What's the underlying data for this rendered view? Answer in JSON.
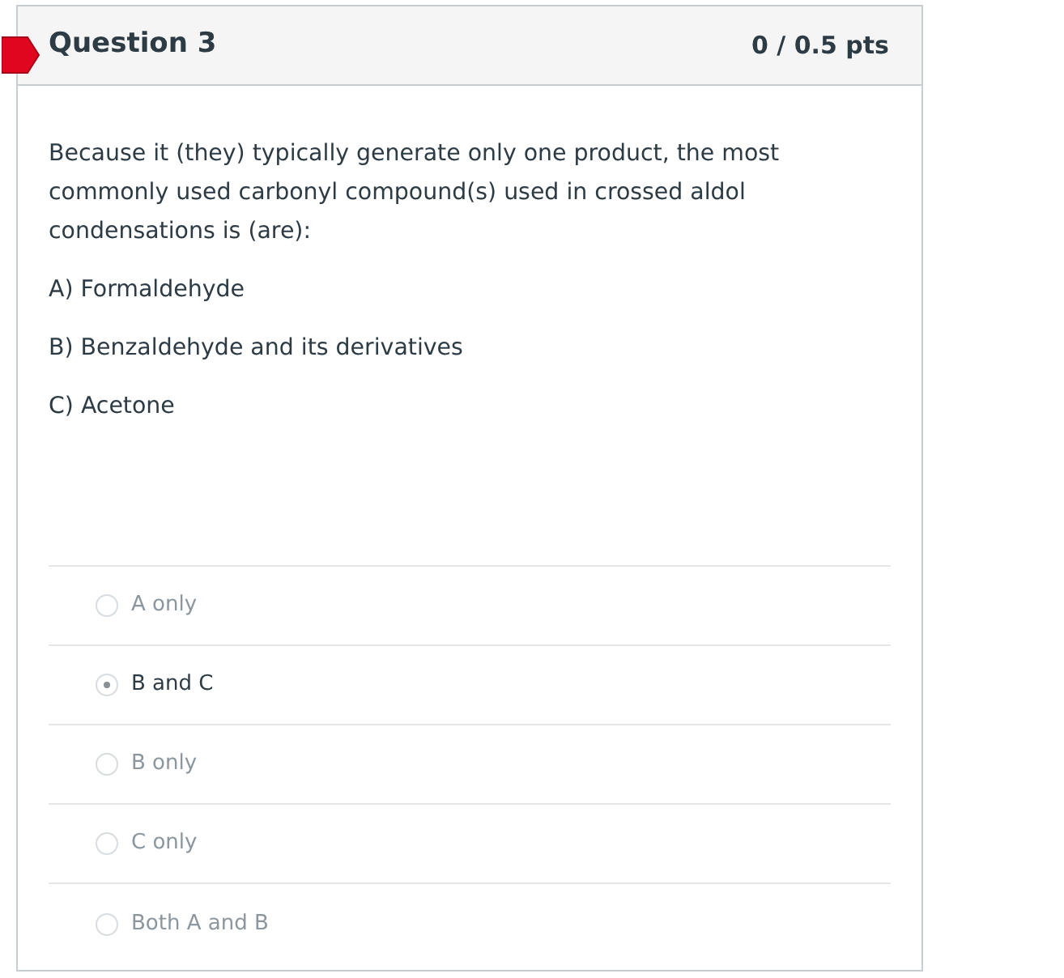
{
  "question": {
    "title": "Question 3",
    "points": "0 / 0.5 pts",
    "incorrect": true,
    "prompt": "Because it (they) typically generate only one product, the most commonly used carbonyl compound(s) used in crossed aldol condensations is (are):",
    "statements": [
      "A) Formaldehyde",
      "B) Benzaldehyde and its derivatives",
      "C) Acetone"
    ],
    "answers": [
      {
        "label": "A only",
        "selected": false
      },
      {
        "label": "B and C",
        "selected": true
      },
      {
        "label": "B only",
        "selected": false
      },
      {
        "label": "C only",
        "selected": false
      },
      {
        "label": "Both A and B",
        "selected": false
      }
    ]
  }
}
